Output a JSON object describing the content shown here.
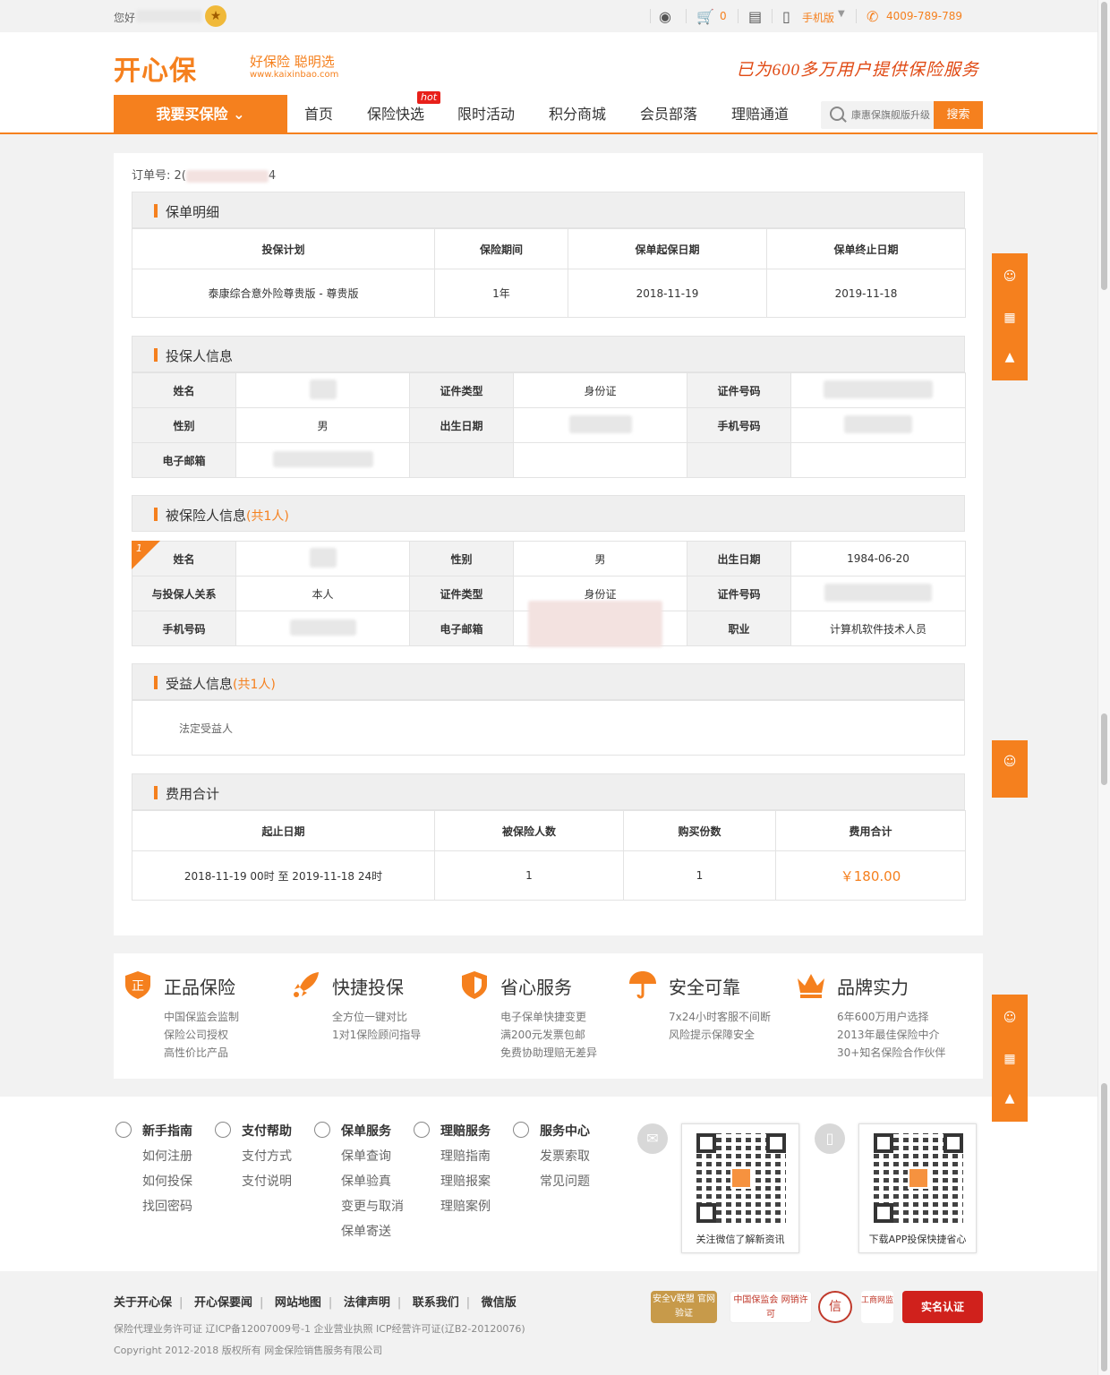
{
  "topbar": {
    "greeting": "您好",
    "cart_count": "0",
    "mobile_label": "手机版",
    "phone": "4009-789-789"
  },
  "header": {
    "brand": "开心保",
    "slogan": "好保险 聪明选",
    "site": "www.kaixinbao.com",
    "tagline": "已为600多万用户提供保险服务"
  },
  "nav": {
    "buy_label": "我要买保险",
    "items": [
      "首页",
      "保险快选",
      "限时活动",
      "积分商城",
      "会员部落",
      "理赔通道"
    ],
    "hot_badge": "hot",
    "search_placeholder": "康惠保旗舰版升级",
    "search_button": "搜索"
  },
  "order": {
    "label": "订单号:",
    "prefix": "2(",
    "suffix": "4"
  },
  "policy": {
    "title": "保单明细",
    "headers": [
      "投保计划",
      "保险期间",
      "保单起保日期",
      "保单终止日期"
    ],
    "row": [
      "泰康综合意外险尊贵版 - 尊贵版",
      "1年",
      "2018-11-19",
      "2019-11-18"
    ]
  },
  "applicant": {
    "title": "投保人信息",
    "labels": [
      "姓名",
      "证件类型",
      "证件号码",
      "性别",
      "出生日期",
      "手机号码",
      "电子邮箱"
    ],
    "id_type": "身份证",
    "gender": "男"
  },
  "insured": {
    "title": "被保险人信息",
    "count": "(共1人)",
    "flag": "1",
    "labels": [
      "姓名",
      "性别",
      "出生日期",
      "与投保人关系",
      "证件类型",
      "证件号码",
      "手机号码",
      "电子邮箱",
      "职业"
    ],
    "gender": "男",
    "birth": "1984-06-20",
    "relation": "本人",
    "id_type": "身份证",
    "occupation": "计算机软件技术人员"
  },
  "beneficiary": {
    "title": "受益人信息",
    "count": "(共1人)",
    "value": "法定受益人"
  },
  "cost": {
    "title": "费用合计",
    "headers": [
      "起止日期",
      "被保险人数",
      "购买份数",
      "费用合计"
    ],
    "row": [
      "2018-11-19 00时 至 2019-11-18 24时",
      "1",
      "1",
      "￥180.00"
    ]
  },
  "features": [
    {
      "title": "正品保险",
      "lines": [
        "中国保监会监制",
        "保险公司授权",
        "高性价比产品"
      ]
    },
    {
      "title": "快捷投保",
      "lines": [
        "全方位一键对比",
        "1对1保险顾问指导"
      ]
    },
    {
      "title": "省心服务",
      "lines": [
        "电子保单快捷变更",
        "满200元发票包邮",
        "免费协助理赔无差异"
      ]
    },
    {
      "title": "安全可靠",
      "lines": [
        "7x24小时客服不间断",
        "风险提示保障安全"
      ]
    },
    {
      "title": "品牌实力",
      "lines": [
        "6年600万用户选择",
        "2013年最佳保险中介",
        "30+知名保险合作伙伴"
      ]
    }
  ],
  "footer_cols": [
    {
      "head": "新手指南",
      "items": [
        "如何注册",
        "如何投保",
        "找回密码"
      ]
    },
    {
      "head": "支付帮助",
      "items": [
        "支付方式",
        "支付说明"
      ]
    },
    {
      "head": "保单服务",
      "items": [
        "保单查询",
        "保单验真",
        "变更与取消",
        "保单寄送"
      ]
    },
    {
      "head": "理赔服务",
      "items": [
        "理赔指南",
        "理赔报案",
        "理赔案例"
      ]
    },
    {
      "head": "服务中心",
      "items": [
        "发票索取",
        "常见问题"
      ]
    }
  ],
  "qr": {
    "wechat_caption": "关注微信了解新资讯",
    "app_caption": "下载APP投保快捷省心"
  },
  "bottom": {
    "links": [
      "关于开心保",
      "开心保要闻",
      "网站地图",
      "法律声明",
      "联系我们",
      "微信版"
    ],
    "license": "保险代理业务许可证  辽ICP备12007009号-1  企业营业执照  ICP经营许可证(辽B2-20120076)",
    "copyright": "Copyright 2012-2018 版权所有 网金保险销售服务有限公司",
    "badges": [
      "安全V联盟 官网验证",
      "中国保监会 网销许可",
      "信",
      "工商网监",
      "实名认证"
    ]
  },
  "colors": {
    "accent": "#f5801e",
    "price": "#f5801e"
  }
}
